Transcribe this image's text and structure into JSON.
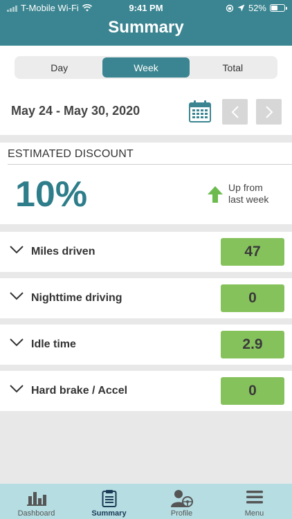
{
  "status_bar": {
    "carrier": "T-Mobile Wi-Fi",
    "time": "9:41 PM",
    "battery": "52%",
    "battery_level": 0.52
  },
  "header": {
    "title": "Summary"
  },
  "period_tabs": [
    {
      "label": "Day",
      "active": false
    },
    {
      "label": "Week",
      "active": true
    },
    {
      "label": "Total",
      "active": false
    }
  ],
  "date_range": "May 24 - May 30, 2020",
  "discount": {
    "label": "ESTIMATED DISCOUNT",
    "value": "10%",
    "trend_line1": "Up from",
    "trend_line2": "last week",
    "trend_color": "#6dbb4f"
  },
  "metrics": [
    {
      "label": "Miles driven",
      "value": "47"
    },
    {
      "label": "Nighttime driving",
      "value": "0"
    },
    {
      "label": "Idle time",
      "value": "2.9"
    },
    {
      "label": "Hard brake / Accel",
      "value": "0"
    }
  ],
  "tabbar": [
    {
      "label": "Dashboard",
      "icon": "bar-chart-icon",
      "active": false
    },
    {
      "label": "Summary",
      "icon": "clipboard-icon",
      "active": true
    },
    {
      "label": "Profile",
      "icon": "driver-icon",
      "active": false
    },
    {
      "label": "Menu",
      "icon": "menu-icon",
      "active": false
    }
  ],
  "colors": {
    "primary": "#3a8591",
    "value_badge": "#86c25c",
    "tabbar": "#b5dde2"
  }
}
